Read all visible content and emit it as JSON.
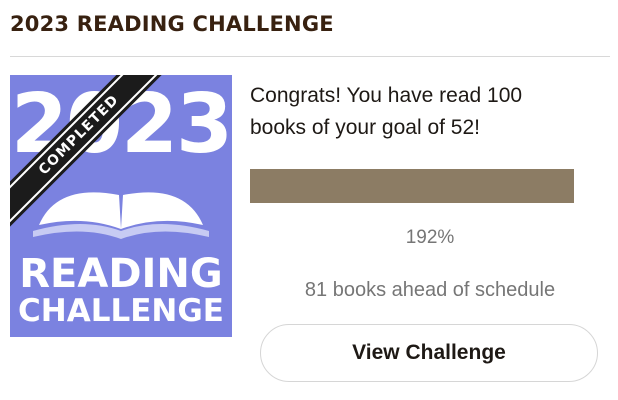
{
  "header": {
    "title": "2023 READING CHALLENGE"
  },
  "badge": {
    "year": "2023",
    "ribbon_label": "COMPLETED",
    "title_line1": "READING",
    "title_line2": "CHALLENGE",
    "background_color": "#7b82e0",
    "icon": "open-book-icon"
  },
  "summary": {
    "message": "Congrats! You have read 100 books of your goal of 52!",
    "progress_fraction": 1.0,
    "percent_label": "192%",
    "schedule_label": "81 books ahead of schedule"
  },
  "actions": {
    "view_label": "View Challenge"
  },
  "colors": {
    "progress_fill": "#8c7c64",
    "header_text": "#382110"
  }
}
